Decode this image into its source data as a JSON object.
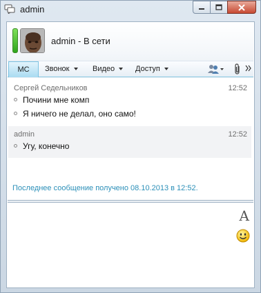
{
  "window": {
    "title": "admin"
  },
  "header": {
    "contact_status_text": "admin - В сети"
  },
  "toolbar": {
    "tabs": [
      {
        "label": "МС"
      },
      {
        "label": "Звонок"
      },
      {
        "label": "Видео"
      },
      {
        "label": "Доступ"
      }
    ]
  },
  "conversation": {
    "blocks": [
      {
        "sender": "Сергей Седельников",
        "time": "12:52",
        "lines": [
          "Почини мне комп",
          "Я ничего не делал, оно само!"
        ]
      },
      {
        "sender": "admin",
        "time": "12:52",
        "lines": [
          "Угу, конечно"
        ]
      }
    ],
    "last_message_status": "Последнее сообщение получено 08.10.2013 в 12:52."
  },
  "colors": {
    "presence_online": "#3fbf2a",
    "active_tab": "#a9dbf1",
    "status_text": "#2b8fb8"
  },
  "icons": [
    "chat-window-icon",
    "minimize-icon",
    "maximize-icon",
    "close-icon",
    "presence-indicator",
    "participants-icon",
    "attachment-icon",
    "overflow-icon",
    "font-icon",
    "emoticon-icon"
  ]
}
